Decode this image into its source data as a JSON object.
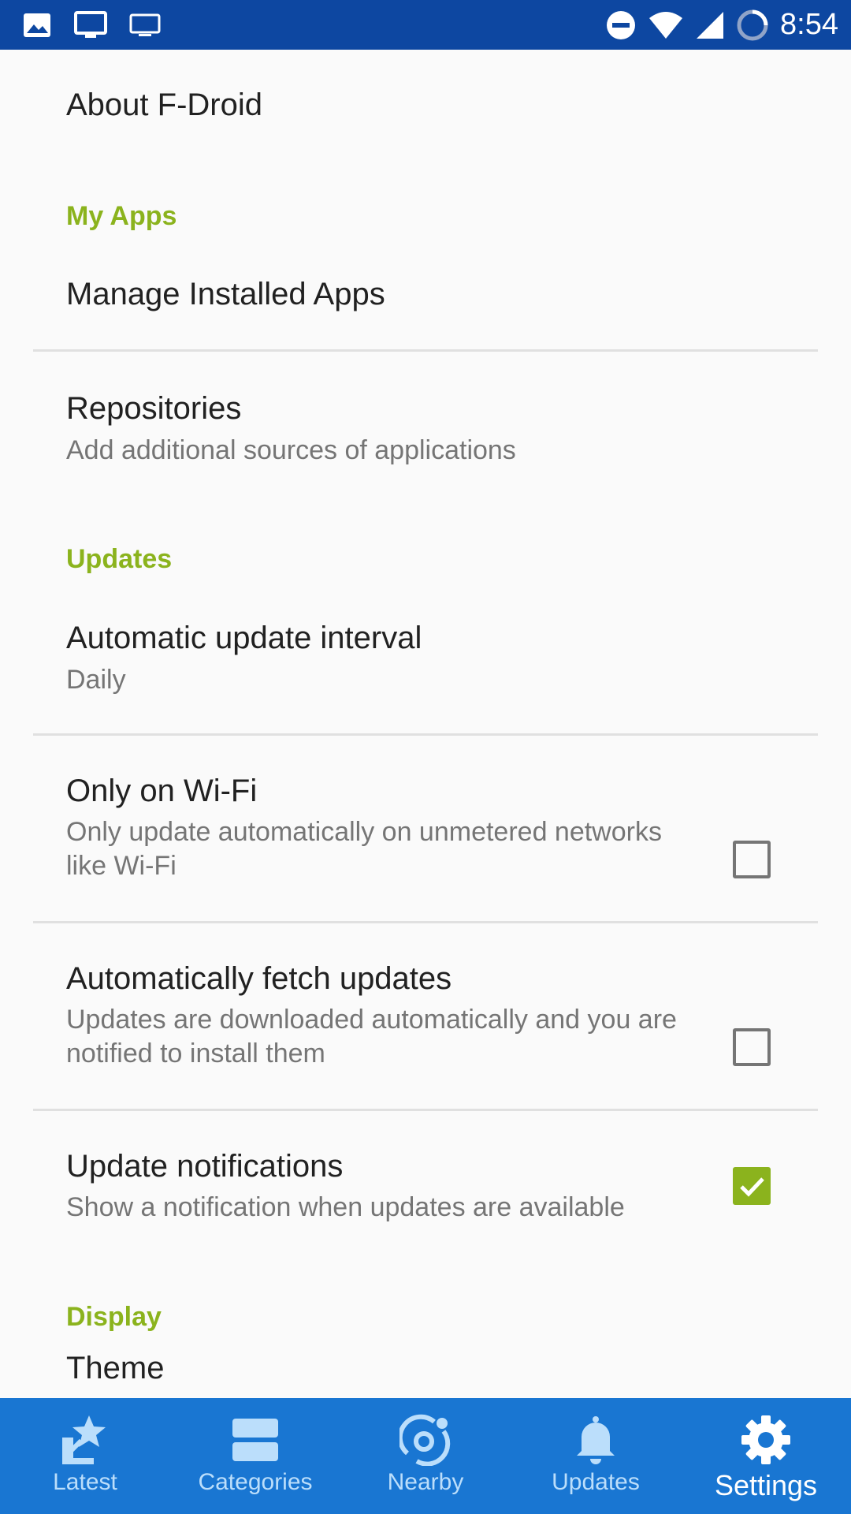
{
  "status_bar": {
    "time": "8:54",
    "left_icons": [
      "image-icon",
      "monitor-icon",
      "cast-icon"
    ],
    "right_icons": [
      "do-not-disturb-icon",
      "wifi-icon",
      "signal-icon",
      "sync-icon"
    ]
  },
  "prefs": {
    "about": {
      "title": "About F-Droid"
    },
    "my_apps_header": "My Apps",
    "manage_apps": {
      "title": "Manage Installed Apps"
    },
    "repositories": {
      "title": "Repositories",
      "summary": "Add additional sources of applications"
    },
    "updates_header": "Updates",
    "update_interval": {
      "title": "Automatic update interval",
      "summary": "Daily"
    },
    "only_wifi": {
      "title": "Only on Wi-Fi",
      "summary": "Only update automatically on unmetered networks like Wi-Fi",
      "checked": false
    },
    "auto_fetch": {
      "title": "Automatically fetch updates",
      "summary": "Updates are downloaded automatically and you are notified to install them",
      "checked": false
    },
    "update_notifications": {
      "title": "Update notifications",
      "summary": "Show a notification when updates are available",
      "checked": true
    },
    "display_header": "Display",
    "theme": {
      "title": "Theme"
    }
  },
  "bottom_nav": {
    "items": [
      {
        "label": "Latest",
        "icon": "latest-icon",
        "active": false
      },
      {
        "label": "Categories",
        "icon": "categories-icon",
        "active": false
      },
      {
        "label": "Nearby",
        "icon": "nearby-icon",
        "active": false
      },
      {
        "label": "Updates",
        "icon": "updates-bell-icon",
        "active": false
      },
      {
        "label": "Settings",
        "icon": "settings-gear-icon",
        "active": true
      }
    ]
  },
  "colors": {
    "status_bar": "#0d47a1",
    "bottom_nav": "#1976d2",
    "accent": "#8bb31d",
    "background": "#fafafa"
  }
}
